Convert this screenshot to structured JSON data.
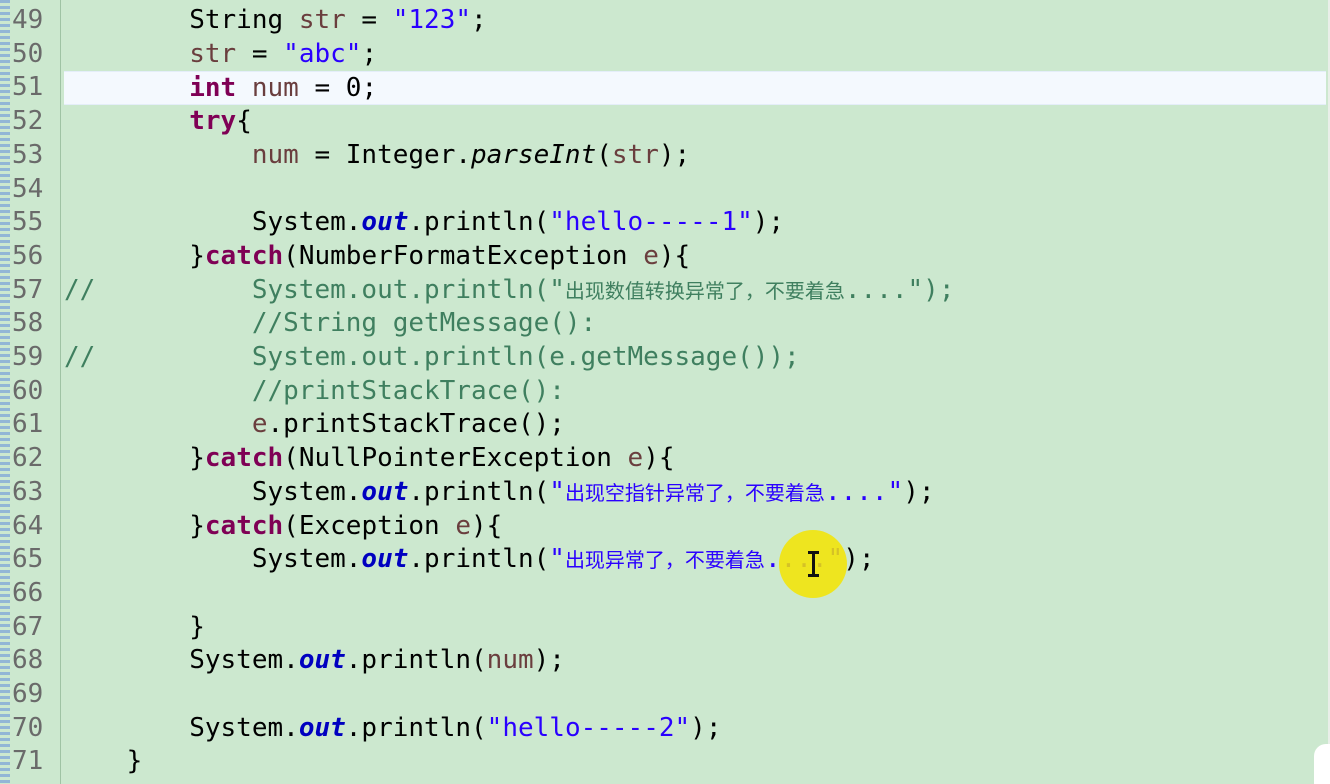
{
  "editor": {
    "lines": [
      {
        "num": "49",
        "tokens": [
          {
            "t": "        String "
          },
          {
            "t": "str",
            "c": "var"
          },
          {
            "t": " = "
          },
          {
            "t": "\"123\"",
            "c": "str"
          },
          {
            "t": ";"
          }
        ]
      },
      {
        "num": "50",
        "tokens": [
          {
            "t": "        "
          },
          {
            "t": "str",
            "c": "var"
          },
          {
            "t": " = "
          },
          {
            "t": "\"abc\"",
            "c": "str"
          },
          {
            "t": ";"
          }
        ]
      },
      {
        "num": "51",
        "current": true,
        "tokens": [
          {
            "t": "        "
          },
          {
            "t": "int",
            "c": "kw"
          },
          {
            "t": " "
          },
          {
            "t": "num",
            "c": "var"
          },
          {
            "t": " = 0;"
          }
        ]
      },
      {
        "num": "52",
        "tokens": [
          {
            "t": "        "
          },
          {
            "t": "try",
            "c": "kw"
          },
          {
            "t": "{"
          }
        ]
      },
      {
        "num": "53",
        "tokens": [
          {
            "t": "            "
          },
          {
            "t": "num",
            "c": "var"
          },
          {
            "t": " = Integer."
          },
          {
            "t": "parseInt",
            "c": "method-static"
          },
          {
            "t": "("
          },
          {
            "t": "str",
            "c": "var"
          },
          {
            "t": ");"
          }
        ]
      },
      {
        "num": "54",
        "tokens": []
      },
      {
        "num": "55",
        "tokens": [
          {
            "t": "            System."
          },
          {
            "t": "out",
            "c": "static"
          },
          {
            "t": ".println("
          },
          {
            "t": "\"hello-----1\"",
            "c": "str"
          },
          {
            "t": ");"
          }
        ]
      },
      {
        "num": "56",
        "tokens": [
          {
            "t": "        }"
          },
          {
            "t": "catch",
            "c": "kw"
          },
          {
            "t": "(NumberFormatException "
          },
          {
            "t": "e",
            "c": "var"
          },
          {
            "t": "){"
          }
        ]
      },
      {
        "num": "57",
        "tokens": [
          {
            "t": "//          System.out.println(\"",
            "c": "cmt"
          },
          {
            "t": "出现数值转换异常了，不要着急",
            "c": "cmt cjk"
          },
          {
            "t": "....\");",
            "c": "cmt"
          }
        ]
      },
      {
        "num": "58",
        "tokens": [
          {
            "t": "            //String getMessage():",
            "c": "cmt"
          }
        ]
      },
      {
        "num": "59",
        "tokens": [
          {
            "t": "//          System.out.println(e.getMessage());",
            "c": "cmt"
          }
        ]
      },
      {
        "num": "60",
        "tokens": [
          {
            "t": "            //printStackTrace():",
            "c": "cmt"
          }
        ]
      },
      {
        "num": "61",
        "tokens": [
          {
            "t": "            "
          },
          {
            "t": "e",
            "c": "var"
          },
          {
            "t": ".printStackTrace();"
          }
        ]
      },
      {
        "num": "62",
        "tokens": [
          {
            "t": "        }"
          },
          {
            "t": "catch",
            "c": "kw"
          },
          {
            "t": "(NullPointerException "
          },
          {
            "t": "e",
            "c": "var"
          },
          {
            "t": "){"
          }
        ]
      },
      {
        "num": "63",
        "tokens": [
          {
            "t": "            System."
          },
          {
            "t": "out",
            "c": "static"
          },
          {
            "t": ".println("
          },
          {
            "t": "\"",
            "c": "str"
          },
          {
            "t": "出现空指针异常了，不要着急",
            "c": "str cjk"
          },
          {
            "t": "....\"",
            "c": "str"
          },
          {
            "t": ");"
          }
        ]
      },
      {
        "num": "64",
        "tokens": [
          {
            "t": "        }"
          },
          {
            "t": "catch",
            "c": "kw"
          },
          {
            "t": "(Exception "
          },
          {
            "t": "e",
            "c": "var"
          },
          {
            "t": "){"
          }
        ]
      },
      {
        "num": "65",
        "tokens": [
          {
            "t": "            System."
          },
          {
            "t": "out",
            "c": "static"
          },
          {
            "t": ".println("
          },
          {
            "t": "\"",
            "c": "str"
          },
          {
            "t": "出现异常了，不要着急",
            "c": "str cjk"
          },
          {
            "t": "....\"",
            "c": "str"
          },
          {
            "t": ");"
          }
        ]
      },
      {
        "num": "66",
        "tokens": []
      },
      {
        "num": "67",
        "tokens": [
          {
            "t": "        }"
          }
        ]
      },
      {
        "num": "68",
        "tokens": [
          {
            "t": "        System."
          },
          {
            "t": "out",
            "c": "static"
          },
          {
            "t": ".println("
          },
          {
            "t": "num",
            "c": "var"
          },
          {
            "t": ");"
          }
        ]
      },
      {
        "num": "69",
        "tokens": []
      },
      {
        "num": "70",
        "tokens": [
          {
            "t": "        System."
          },
          {
            "t": "out",
            "c": "static"
          },
          {
            "t": ".println("
          },
          {
            "t": "\"hello-----2\"",
            "c": "str"
          },
          {
            "t": ");"
          }
        ]
      },
      {
        "num": "71",
        "tokens": [
          {
            "t": "    }"
          }
        ]
      }
    ]
  },
  "colors": {
    "background": "#cce8cf",
    "current_line": "#f4f9fe",
    "keyword": "#7f0055",
    "string": "#2a00ff",
    "variable": "#6a3e3e",
    "static_field": "#0000c0",
    "comment": "#3f7f5f",
    "cursor_highlight": "#f3e400"
  }
}
